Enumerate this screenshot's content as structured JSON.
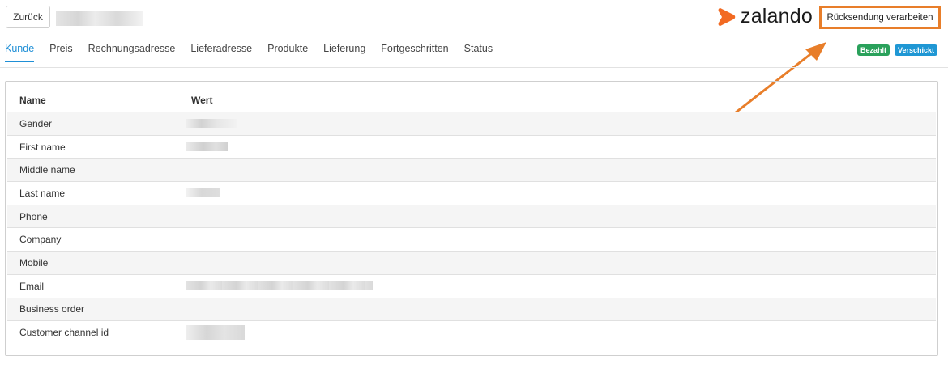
{
  "header": {
    "back_label": "Zurück",
    "logo_text": "zalando",
    "process_label": "Rücksendung verarbeiten"
  },
  "tabs": [
    {
      "label": "Kunde",
      "active": true
    },
    {
      "label": "Preis"
    },
    {
      "label": "Rechnungsadresse"
    },
    {
      "label": "Lieferadresse"
    },
    {
      "label": "Produkte"
    },
    {
      "label": "Lieferung"
    },
    {
      "label": "Fortgeschritten"
    },
    {
      "label": "Status"
    }
  ],
  "badges": {
    "paid": "Bezahlt",
    "shipped": "Verschickt"
  },
  "table": {
    "col_name": "Name",
    "col_value": "Wert",
    "rows": [
      {
        "name": "Gender"
      },
      {
        "name": "First name"
      },
      {
        "name": "Middle name"
      },
      {
        "name": "Last name"
      },
      {
        "name": "Phone"
      },
      {
        "name": "Company"
      },
      {
        "name": "Mobile"
      },
      {
        "name": "Email"
      },
      {
        "name": "Business order"
      },
      {
        "name": "Customer channel id"
      }
    ]
  },
  "colors": {
    "accent": "#1f8fd6",
    "highlight": "#e87e2a",
    "logo_orange": "#f26a22",
    "paid": "#2aa15b",
    "shipped": "#1f97d4"
  }
}
